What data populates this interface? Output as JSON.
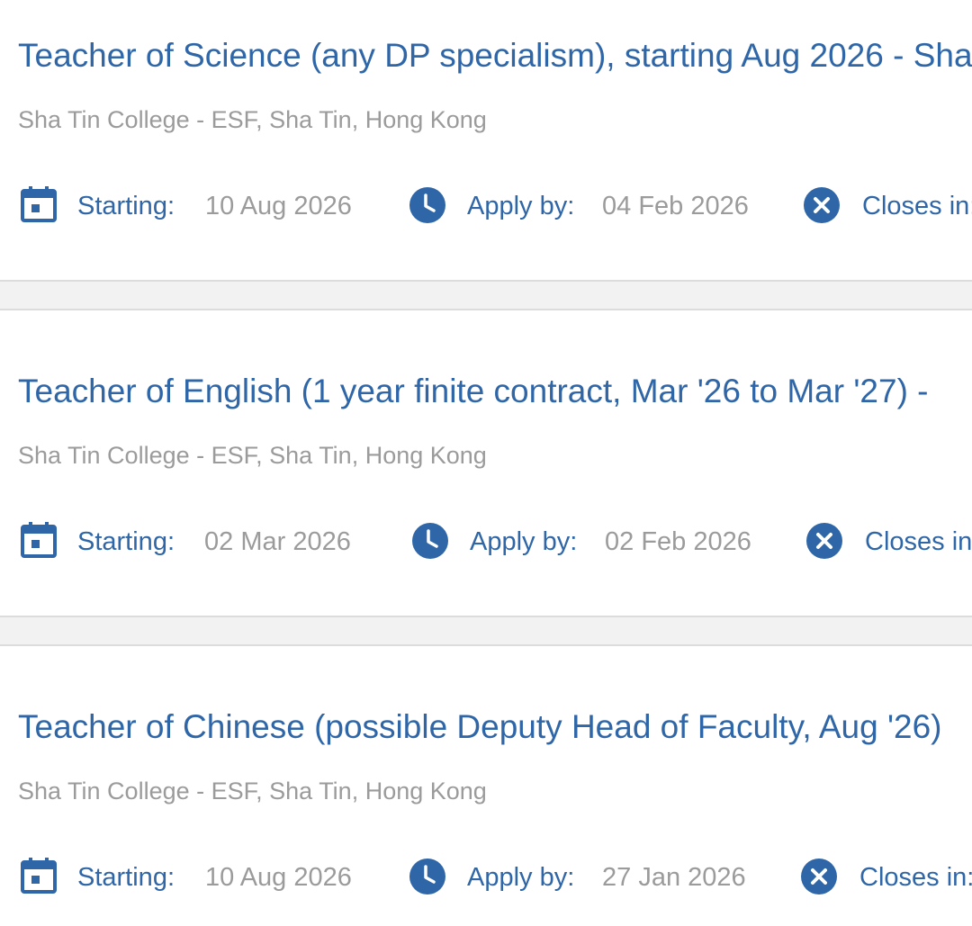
{
  "jobs": [
    {
      "title": "Teacher of Science (any DP specialism), starting Aug 2026 - Sha",
      "location": "Sha Tin College - ESF, Sha Tin, Hong Kong",
      "starting_label": "Starting:",
      "starting_value": "10 Aug 2026",
      "apply_label": "Apply by:",
      "apply_value": "04 Feb 2026",
      "closes_label": "Closes in:"
    },
    {
      "title": "Teacher of English (1 year finite contract, Mar '26 to Mar '27) -",
      "location": "Sha Tin College - ESF, Sha Tin, Hong Kong",
      "starting_label": "Starting:",
      "starting_value": "02 Mar 2026",
      "apply_label": "Apply by:",
      "apply_value": "02 Feb 2026",
      "closes_label": "Closes in:"
    },
    {
      "title": "Teacher of Chinese (possible Deputy Head of Faculty, Aug '26)",
      "location": "Sha Tin College - ESF, Sha Tin, Hong Kong",
      "starting_label": "Starting:",
      "starting_value": "10 Aug 2026",
      "apply_label": "Apply by:",
      "apply_value": "27 Jan 2026",
      "closes_label": "Closes in:"
    }
  ],
  "icons": {
    "starting": "calendar-icon",
    "apply": "clock-icon",
    "closes": "close-circle-icon"
  },
  "colors": {
    "accent": "#2f66a7",
    "muted_text": "#9b9b9b",
    "separator": "#f2f2f2"
  }
}
